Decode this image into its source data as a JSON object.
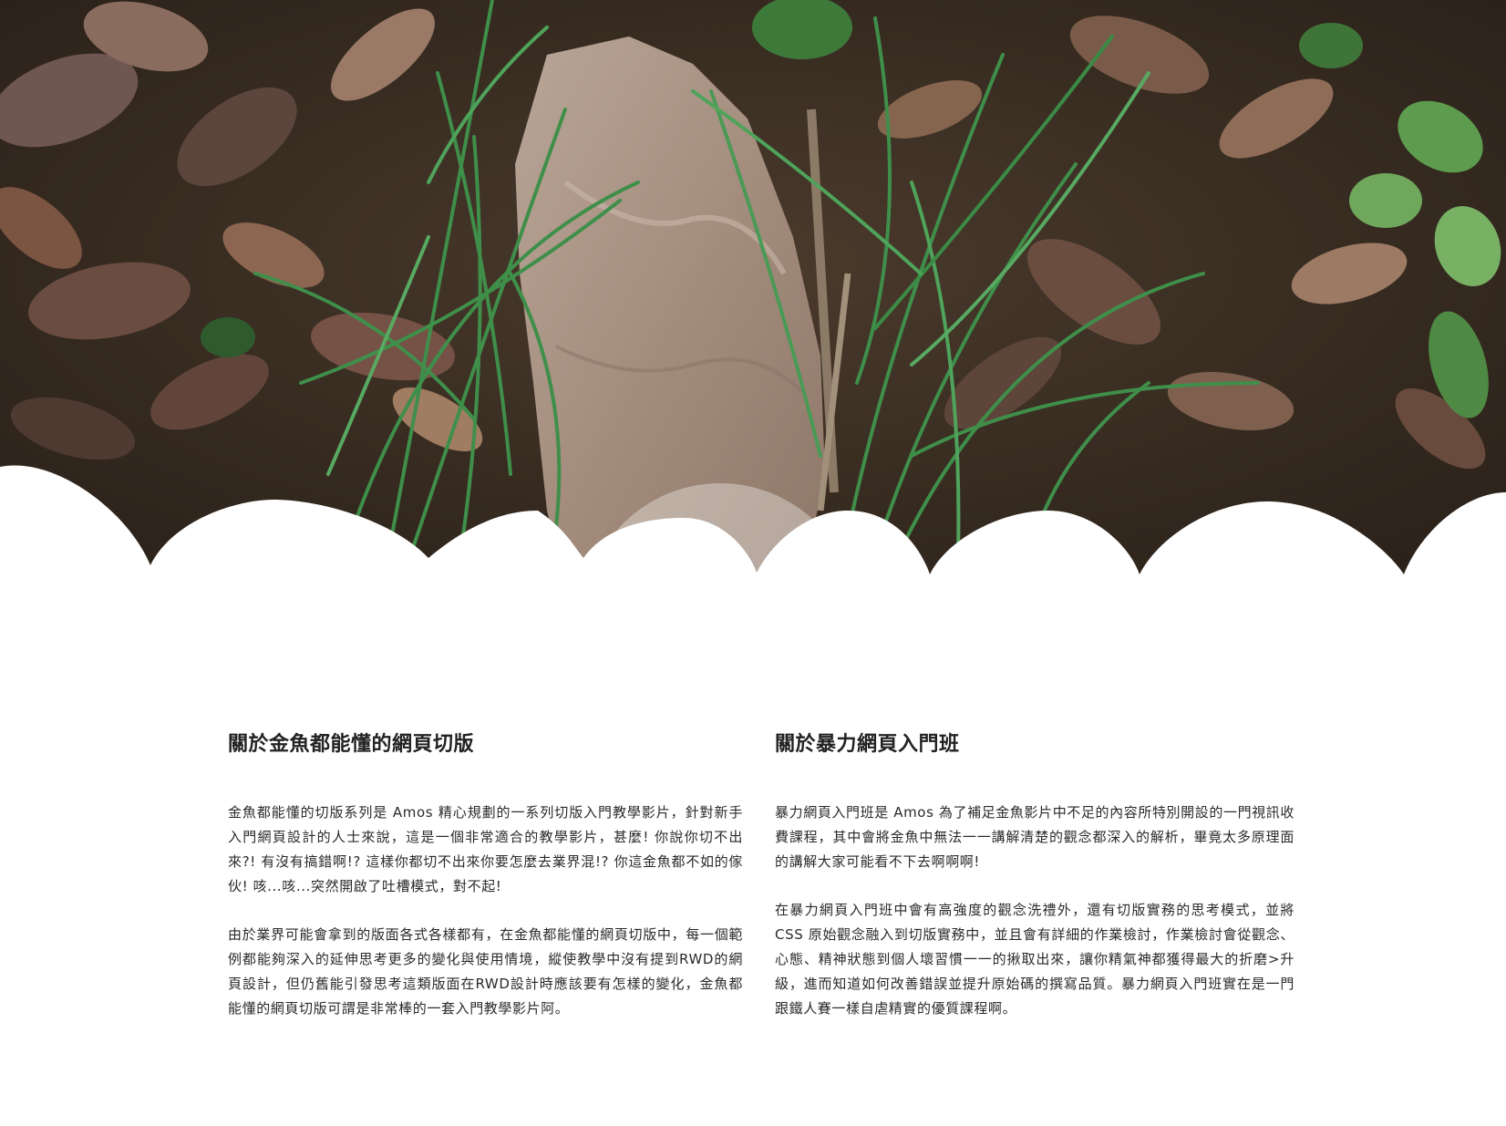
{
  "hero": {
    "image_alt": "leaves, grass and a rock on the ground",
    "edge_shape": "scalloped-cloud"
  },
  "sections": [
    {
      "title": "關於金魚都能懂的網頁切版",
      "paragraphs": [
        "金魚都能懂的切版系列是 Amos 精心規劃的一系列切版入門教學影片，針對新手入門網頁設計的人士來說，這是一個非常適合的教學影片，甚麼! 你說你切不出來?! 有沒有搞錯啊!? 這樣你都切不出來你要怎麼去業界混!? 你這金魚都不如的傢伙! 咳...咳...突然開啟了吐槽模式，對不起!",
        "由於業界可能會拿到的版面各式各樣都有，在金魚都能懂的網頁切版中，每一個範例都能夠深入的延伸思考更多的變化與使用情境，縱使教學中沒有提到RWD的網頁設計，但仍舊能引發思考這類版面在RWD設計時應該要有怎樣的變化，金魚都能懂的網頁切版可謂是非常棒的一套入門教學影片阿。"
      ]
    },
    {
      "title": "關於暴力網頁入門班",
      "paragraphs": [
        "暴力網頁入門班是 Amos 為了補足金魚影片中不足的內容所特別開設的一門視訊收費課程，其中會將金魚中無法一一講解清楚的觀念都深入的解析，畢竟太多原理面的講解大家可能看不下去啊啊啊!",
        "在暴力網頁入門班中會有高強度的觀念洗禮外，還有切版實務的思考模式，並將 CSS 原始觀念融入到切版實務中，並且會有詳細的作業檢討，作業檢討會從觀念、心態、精神狀態到個人壞習慣一一的揪取出來，讓你精氣神都獲得最大的折磨>升級，進而知道如何改善錯誤並提升原始碼的撰寫品質。暴力網頁入門班實在是一門跟鐵人賽一樣自虐精實的優質課程啊。"
      ]
    }
  ],
  "colors": {
    "background": "#ffffff",
    "text": "#2a2a2a",
    "title": "#222222",
    "soil": "#3b2e24",
    "grass": "#3f8f4a",
    "rock": "#a89485",
    "leaf": "#7a5a48"
  }
}
